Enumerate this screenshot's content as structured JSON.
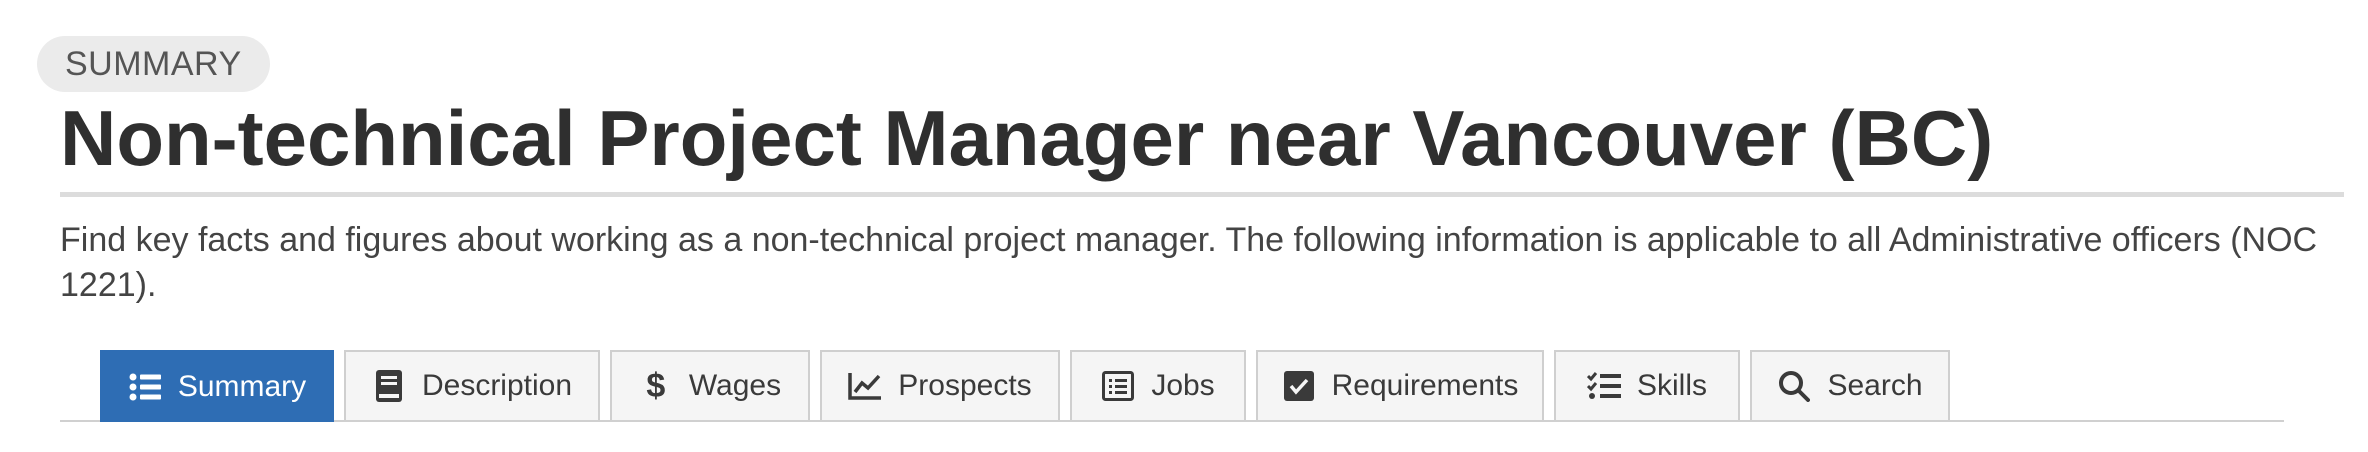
{
  "header": {
    "badge": "SUMMARY",
    "title": "Non-technical Project Manager near Vancouver (BC)",
    "description": "Find key facts and figures about working as a non-technical project manager. The following information is applicable to all Administrative officers (NOC 1221)."
  },
  "tabs": [
    {
      "label": "Summary",
      "icon": "list-icon",
      "active": true
    },
    {
      "label": "Description",
      "icon": "book-icon",
      "active": false
    },
    {
      "label": "Wages",
      "icon": "dollar-icon",
      "active": false
    },
    {
      "label": "Prospects",
      "icon": "chart-line-icon",
      "active": false
    },
    {
      "label": "Jobs",
      "icon": "list-alt-icon",
      "active": false
    },
    {
      "label": "Requirements",
      "icon": "check-square-icon",
      "active": false
    },
    {
      "label": "Skills",
      "icon": "tasks-icon",
      "active": false
    },
    {
      "label": "Search",
      "icon": "search-icon",
      "active": false
    }
  ],
  "colors": {
    "accent": "#2e6db4",
    "tab_bg": "#f5f5f5",
    "badge_bg": "#ebebeb"
  }
}
